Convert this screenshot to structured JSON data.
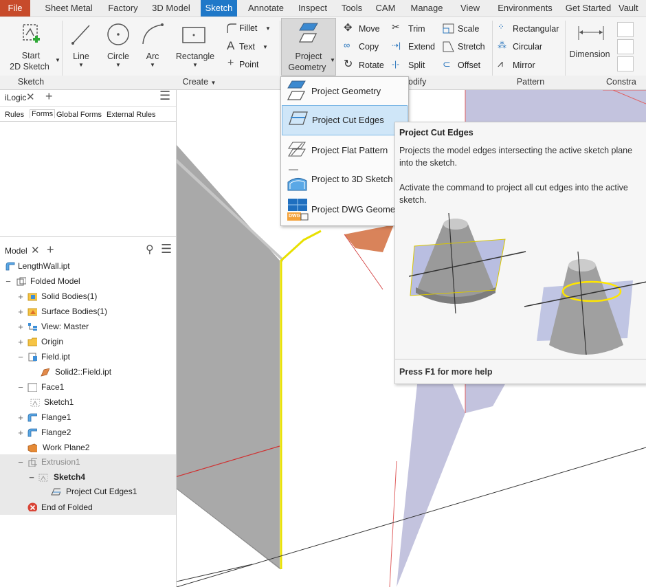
{
  "menu_tabs": [
    "File",
    "Sheet Metal",
    "Factory",
    "3D Model",
    "Sketch",
    "Annotate",
    "Inspect",
    "Tools",
    "CAM",
    "Manage",
    "View",
    "Environments",
    "Get Started",
    "Vault"
  ],
  "ribbon": {
    "start_sketch": {
      "line1": "Start",
      "line2": "2D Sketch"
    },
    "line": "Line",
    "circle": "Circle",
    "arc": "Arc",
    "rectangle": "Rectangle",
    "fillet": "Fillet",
    "text": "Text",
    "point": "Point",
    "project_geometry": {
      "line1": "Project",
      "line2": "Geometry"
    },
    "move": "Move",
    "copy": "Copy",
    "rotate": "Rotate",
    "trim": "Trim",
    "extend": "Extend",
    "split": "Split",
    "scale": "Scale",
    "stretch": "Stretch",
    "offset": "Offset",
    "rectangular": "Rectangular",
    "circular": "Circular",
    "mirror": "Mirror",
    "dimension": "Dimension",
    "groups": {
      "sketch": "Sketch",
      "create": "Create",
      "modify": "odify",
      "pattern": "Pattern",
      "constrain": "Constra"
    }
  },
  "ilogic_panel": {
    "title": "iLogic",
    "tabs": [
      "Rules",
      "Forms",
      "Global Forms",
      "External Rules"
    ]
  },
  "model_panel": {
    "title": "Model",
    "tree": [
      {
        "label": "LengthWall.ipt"
      },
      {
        "label": "Folded Model"
      },
      {
        "label": "Solid Bodies(1)"
      },
      {
        "label": "Surface Bodies(1)"
      },
      {
        "label": "View: Master"
      },
      {
        "label": "Origin"
      },
      {
        "label": "Field.ipt"
      },
      {
        "label": "Solid2::Field.ipt"
      },
      {
        "label": "Face1"
      },
      {
        "label": "Sketch1"
      },
      {
        "label": "Flange1"
      },
      {
        "label": "Flange2"
      },
      {
        "label": "Work Plane2"
      },
      {
        "label": "Extrusion1"
      },
      {
        "label": "Sketch4"
      },
      {
        "label": "Project Cut Edges1"
      },
      {
        "label": "End of Folded"
      }
    ]
  },
  "dropdown": [
    {
      "label": "Project Geometry"
    },
    {
      "label": "Project Cut Edges"
    },
    {
      "label": "Project Flat Pattern"
    },
    {
      "label": "Project to 3D Sketch"
    },
    {
      "label": "Project DWG Geomet"
    }
  ],
  "tooltip": {
    "title": "Project Cut Edges",
    "desc1": "Projects the model edges intersecting the active sketch plane into the sketch.",
    "desc2": "Activate the command to project all cut edges into the active sketch.",
    "help": "Press F1 for more help"
  },
  "dwg_badge": "DWG",
  "colors": {
    "file_tab": "#c74b2b",
    "active_tab": "#1f78c8",
    "selection": "#cfe6f8",
    "highlight_edge": "#e8e000",
    "sketch_line": "#d03030"
  }
}
